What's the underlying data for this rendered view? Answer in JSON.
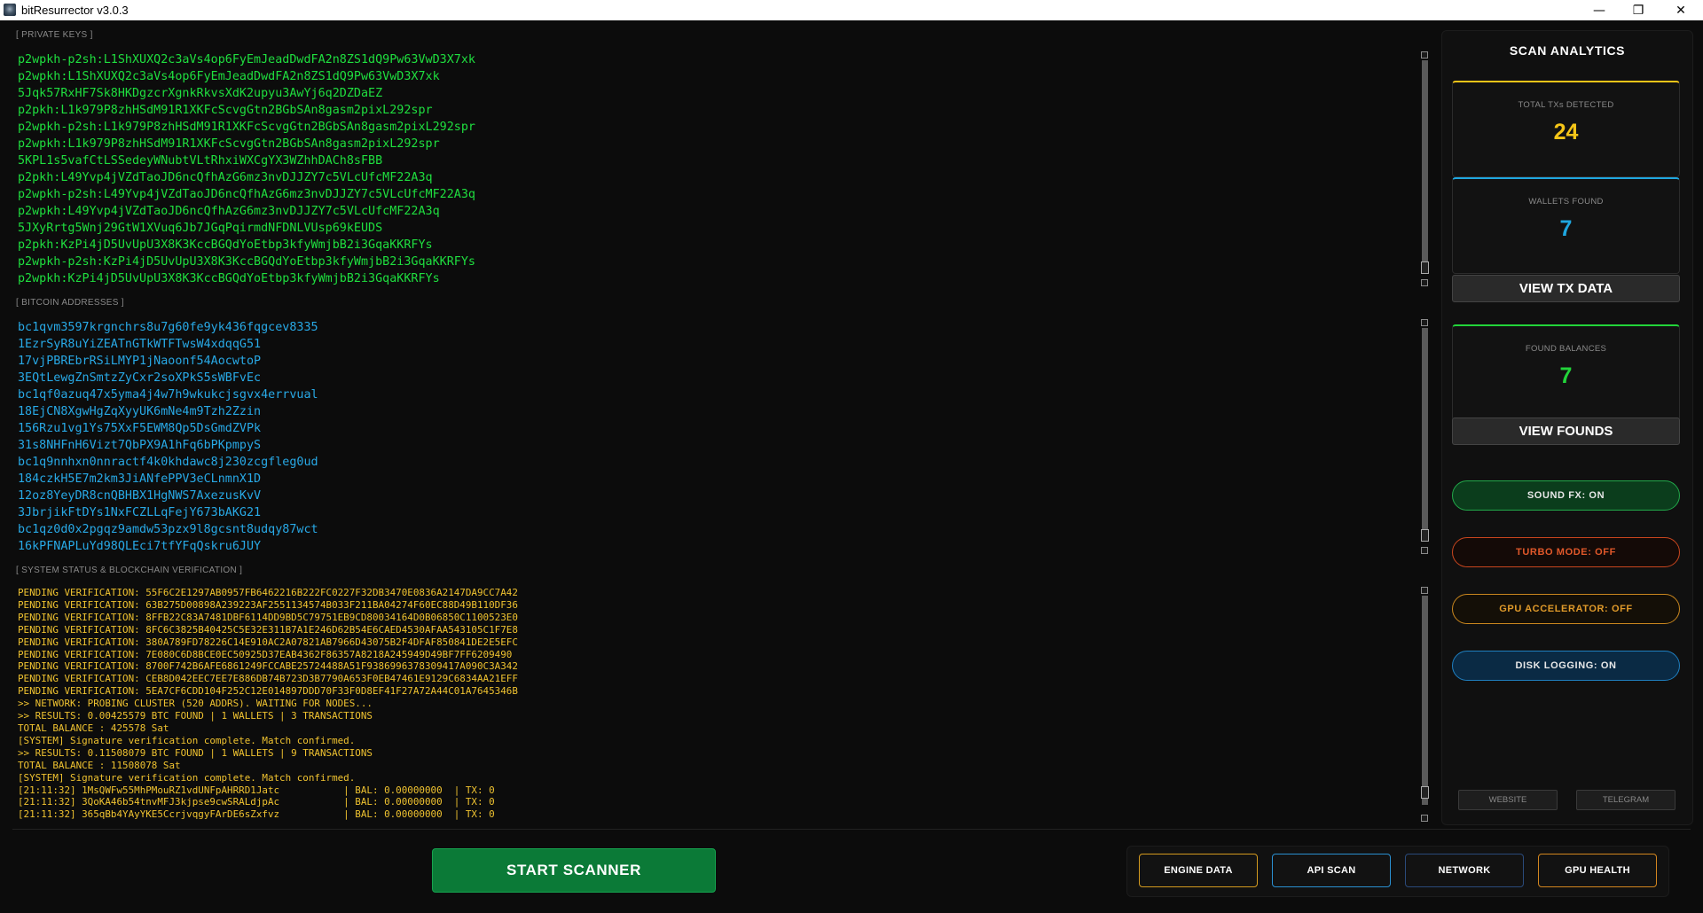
{
  "window": {
    "title": "bitResurrector v3.0.3",
    "controls": [
      "minimize-icon",
      "restore-icon",
      "close-icon"
    ]
  },
  "sections": {
    "private_keys_label": "[ PRIVATE KEYS ]",
    "addresses_label": "[ BITCOIN ADDRESSES ]",
    "status_label": "[ SYSTEM STATUS & BLOCKCHAIN VERIFICATION ]"
  },
  "private_keys": [
    "p2wpkh-p2sh:L1ShXUXQ2c3aVs4op6FyEmJeadDwdFA2n8ZS1dQ9Pw63VwD3X7xk",
    "p2wpkh:L1ShXUXQ2c3aVs4op6FyEmJeadDwdFA2n8ZS1dQ9Pw63VwD3X7xk",
    "5Jqk57RxHF7Sk8HKDgzcrXgnkRkvsXdK2upyu3AwYj6q2DZDaEZ",
    "p2pkh:L1k979P8zhHSdM91R1XKFcScvgGtn2BGbSAn8gasm2pixL292spr",
    "p2wpkh-p2sh:L1k979P8zhHSdM91R1XKFcScvgGtn2BGbSAn8gasm2pixL292spr",
    "p2wpkh:L1k979P8zhHSdM91R1XKFcScvgGtn2BGbSAn8gasm2pixL292spr",
    "5KPL1s5vafCtLSSedeyWNubtVLtRhxiWXCgYX3WZhhDACh8sFBB",
    "p2pkh:L49Yvp4jVZdTaoJD6ncQfhAzG6mz3nvDJJZY7c5VLcUfcMF22A3q",
    "p2wpkh-p2sh:L49Yvp4jVZdTaoJD6ncQfhAzG6mz3nvDJJZY7c5VLcUfcMF22A3q",
    "p2wpkh:L49Yvp4jVZdTaoJD6ncQfhAzG6mz3nvDJJZY7c5VLcUfcMF22A3q",
    "5JXyRrtg5Wnj29GtW1XVuq6Jb7JGqPqirmdNFDNLVUsp69kEUDS",
    "p2pkh:KzPi4jD5UvUpU3X8K3KccBGQdYoEtbp3kfyWmjbB2i3GqaKKRFYs",
    "p2wpkh-p2sh:KzPi4jD5UvUpU3X8K3KccBGQdYoEtbp3kfyWmjbB2i3GqaKKRFYs",
    "p2wpkh:KzPi4jD5UvUpU3X8K3KccBGQdYoEtbp3kfyWmjbB2i3GqaKKRFYs"
  ],
  "addresses": [
    "bc1qvm3597krgnchrs8u7g60fe9yk436fqgcev8335",
    "1EzrSyR8uYiZEATnGTkWTFTwsW4xdqqG51",
    "17vjPBREbrRSiLMYP1jNaoonf54AocwtoP",
    "3EQtLewgZnSmtzZyCxr2soXPkS5sWBFvEc",
    "bc1qf0azuq47x5yma4j4w7h9wkukcjsgvx4errvual",
    "18EjCN8XgwHgZqXyyUK6mNe4m9Tzh2Zzin",
    "156Rzu1vg1Ys75XxF5EWM8Qp5DsGmdZVPk",
    "31s8NHFnH6Vizt7QbPX9A1hFq6bPKpmpyS",
    "bc1q9nnhxn0nnractf4k0khdawc8j230zcgfleg0ud",
    "184czkH5E7m2km3JiANfePPV3eCLnmnX1D",
    "12oz8YeyDR8cnQBHBX1HgNWS7AxezusKvV",
    "3JbrjikFtDYs1NxFCZLLqFejY673bAKG21",
    "bc1qz0d0x2pgqz9amdw53pzx9l8gcsnt8udqy87wct",
    "16kPFNAPLuYd98QLEci7tfYFqQskru6JUY"
  ],
  "status_log": [
    "PENDING VERIFICATION: 55F6C2E1297AB0957FB6462216B222FC0227F32DB3470E0836A2147DA9CC7A42",
    "PENDING VERIFICATION: 63B275D00898A239223AF2551134574B033F211BA04274F60EC88D49B110DF36",
    "PENDING VERIFICATION: 8FFB22C83A7481DBF6114DD9BD5C79751EB9CD80034164D0B06850C1100523E0",
    "PENDING VERIFICATION: 8FC6C3825B40425C5E32E311B7A1E246D62B54E6CAED4530AFAA543105C1F7E8",
    "PENDING VERIFICATION: 380A789FD78226C14E910AC2A07821AB7966D43075B2F4DFAF850841DE2E5EFC",
    "PENDING VERIFICATION: 7E080C6D8BCE0EC50925D37EAB4362F86357A8218A245949D49BF7FF6209490",
    "PENDING VERIFICATION: 8700F742B6AFE6861249FCCABE25724488A51F9386996378309417A090C3A342",
    "PENDING VERIFICATION: CEB8D042EEC7EE7E886DB74B723D3B7790A653F0EB47461E9129C6834AA21EFF",
    "PENDING VERIFICATION: 5EA7CF6CDD104F252C12E014897DDD70F33F0D8EF41F27A72A44C01A7645346B",
    ">> NETWORK: PROBING CLUSTER (520 ADDRS). WAITING FOR NODES...",
    ">> RESULTS: 0.00425579 BTC FOUND | 1 WALLETS | 3 TRANSACTIONS",
    "TOTAL BALANCE : 425578 Sat",
    "[SYSTEM] Signature verification complete. Match confirmed.",
    ">> RESULTS: 0.11508079 BTC FOUND | 1 WALLETS | 9 TRANSACTIONS",
    "TOTAL BALANCE : 11508078 Sat",
    "[SYSTEM] Signature verification complete. Match confirmed.",
    "[21:11:32] 1MsQWFw55MhPMouRZ1vdUNFpAHRRD1Jatc           | BAL: 0.00000000  | TX: 0",
    "[21:11:32] 3QoKA46b54tnvMFJ3kjpse9cwSRALdjpAc           | BAL: 0.00000000  | TX: 0",
    "[21:11:32] 365qBb4YAyYKE5CcrjvqgyFArDE6sZxfvz           | BAL: 0.00000000  | TX: 0"
  ],
  "analytics": {
    "title": "SCAN ANALYTICS",
    "total_tx_label": "TOTAL TXs DETECTED",
    "total_tx_value": "24",
    "wallets_label": "WALLETS FOUND",
    "wallets_value": "7",
    "view_tx_label": "VIEW TX DATA",
    "balances_label": "FOUND BALANCES",
    "balances_value": "7",
    "view_founds_label": "VIEW FOUNDS",
    "colors": {
      "tx_accent": "#f5c518",
      "wallets_accent": "#1fa7e0",
      "balances_accent": "#22d43a"
    }
  },
  "toggles": {
    "sound_fx": "SOUND FX: ON",
    "turbo_mode": "TURBO MODE: OFF",
    "gpu_accelerator": "GPU ACCELERATOR: OFF",
    "disk_logging": "DISK LOGGING: ON"
  },
  "links": {
    "website": "WEBSITE",
    "telegram": "TELEGRAM"
  },
  "bottom": {
    "start_label": "START SCANNER",
    "engine_data": "ENGINE DATA",
    "api_scan": "API SCAN",
    "network": "NETWORK",
    "gpu_health": "GPU HEALTH"
  }
}
